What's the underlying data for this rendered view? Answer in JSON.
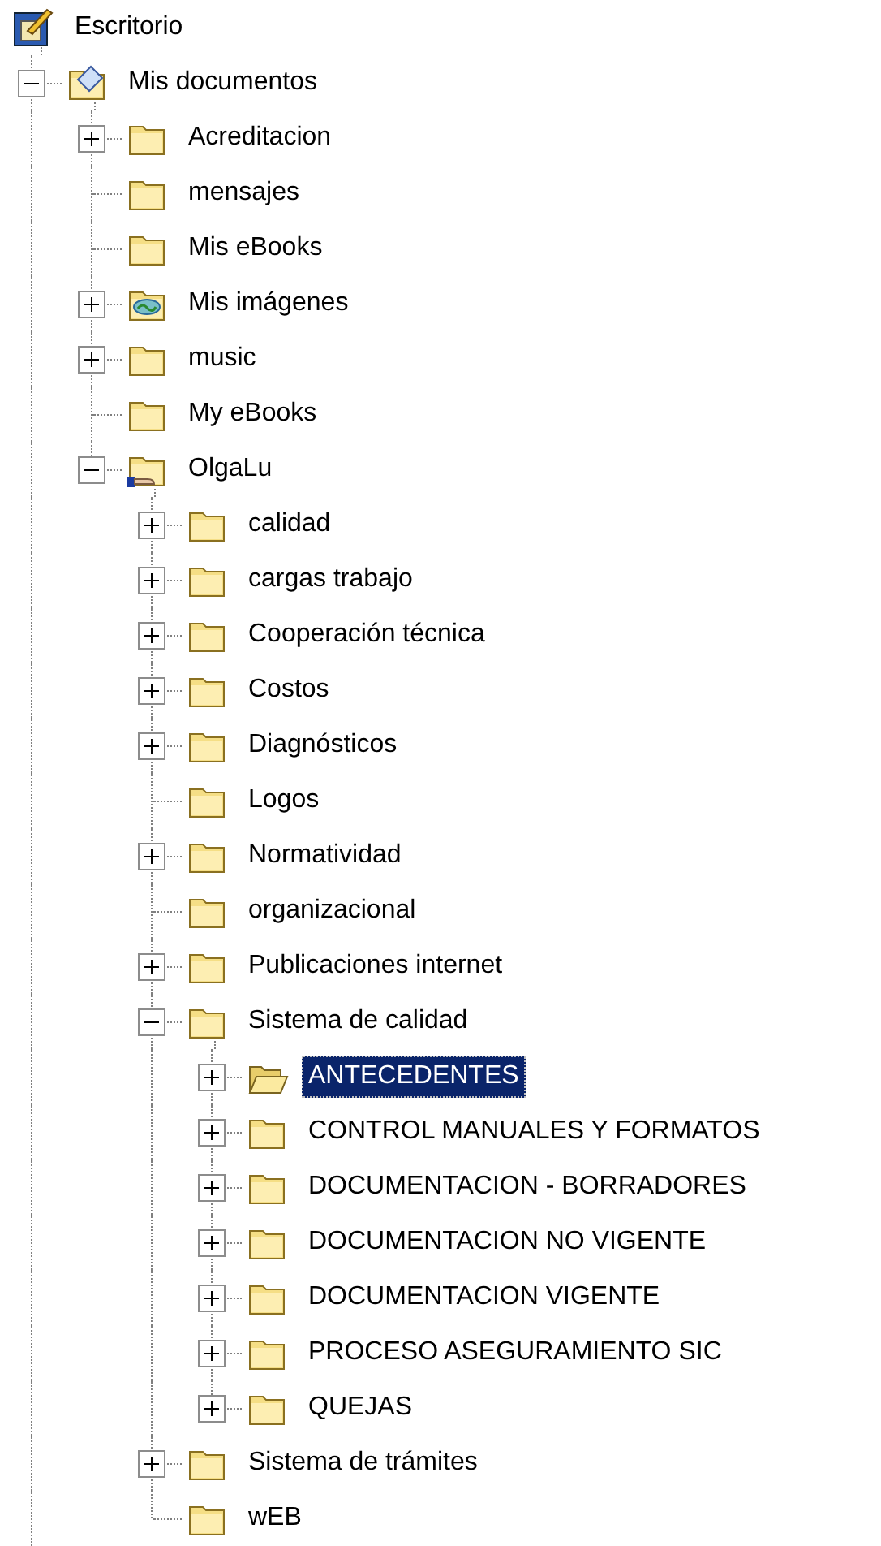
{
  "tree": [
    {
      "label": "Escritorio",
      "kind": "desktop",
      "selected": false,
      "children": [
        {
          "label": "Mis documentos",
          "kind": "documents",
          "expanded": true,
          "selected": false,
          "children": [
            {
              "label": "Acreditacion",
              "kind": "folder",
              "expanded": false,
              "selected": false
            },
            {
              "label": "mensajes",
              "kind": "folder",
              "selected": false
            },
            {
              "label": "Mis eBooks",
              "kind": "folder",
              "selected": false
            },
            {
              "label": "Mis imágenes",
              "kind": "pictures",
              "expanded": false,
              "selected": false
            },
            {
              "label": "music",
              "kind": "folder",
              "expanded": false,
              "selected": false
            },
            {
              "label": "My eBooks",
              "kind": "folder",
              "selected": false
            },
            {
              "label": "OlgaLu",
              "kind": "shared",
              "expanded": true,
              "selected": false,
              "children": [
                {
                  "label": "calidad",
                  "kind": "folder",
                  "expanded": false,
                  "selected": false
                },
                {
                  "label": "cargas trabajo",
                  "kind": "folder",
                  "expanded": false,
                  "selected": false
                },
                {
                  "label": "Cooperación técnica",
                  "kind": "folder",
                  "expanded": false,
                  "selected": false
                },
                {
                  "label": "Costos",
                  "kind": "folder",
                  "expanded": false,
                  "selected": false
                },
                {
                  "label": "Diagnósticos",
                  "kind": "folder",
                  "expanded": false,
                  "selected": false
                },
                {
                  "label": "Logos",
                  "kind": "folder",
                  "selected": false
                },
                {
                  "label": "Normatividad",
                  "kind": "folder",
                  "expanded": false,
                  "selected": false
                },
                {
                  "label": "organizacional",
                  "kind": "folder",
                  "selected": false
                },
                {
                  "label": "Publicaciones internet",
                  "kind": "folder",
                  "expanded": false,
                  "selected": false
                },
                {
                  "label": "Sistema de calidad",
                  "kind": "folder",
                  "expanded": true,
                  "selected": false,
                  "children": [
                    {
                      "label": "ANTECEDENTES",
                      "kind": "folder",
                      "expanded": false,
                      "selected": true
                    },
                    {
                      "label": "CONTROL MANUALES Y FORMATOS",
                      "kind": "folder",
                      "expanded": false,
                      "selected": false
                    },
                    {
                      "label": "DOCUMENTACION - BORRADORES",
                      "kind": "folder",
                      "expanded": false,
                      "selected": false
                    },
                    {
                      "label": "DOCUMENTACION NO VIGENTE",
                      "kind": "folder",
                      "expanded": false,
                      "selected": false
                    },
                    {
                      "label": "DOCUMENTACION VIGENTE",
                      "kind": "folder",
                      "expanded": false,
                      "selected": false
                    },
                    {
                      "label": "PROCESO ASEGURAMIENTO SIC",
                      "kind": "folder",
                      "expanded": false,
                      "selected": false
                    },
                    {
                      "label": "QUEJAS",
                      "kind": "folder",
                      "expanded": false,
                      "selected": false
                    }
                  ]
                },
                {
                  "label": "Sistema de trámites",
                  "kind": "folder",
                  "expanded": false,
                  "selected": false
                },
                {
                  "label": "wEB",
                  "kind": "folder",
                  "selected": false
                }
              ]
            }
          ]
        }
      ]
    }
  ]
}
